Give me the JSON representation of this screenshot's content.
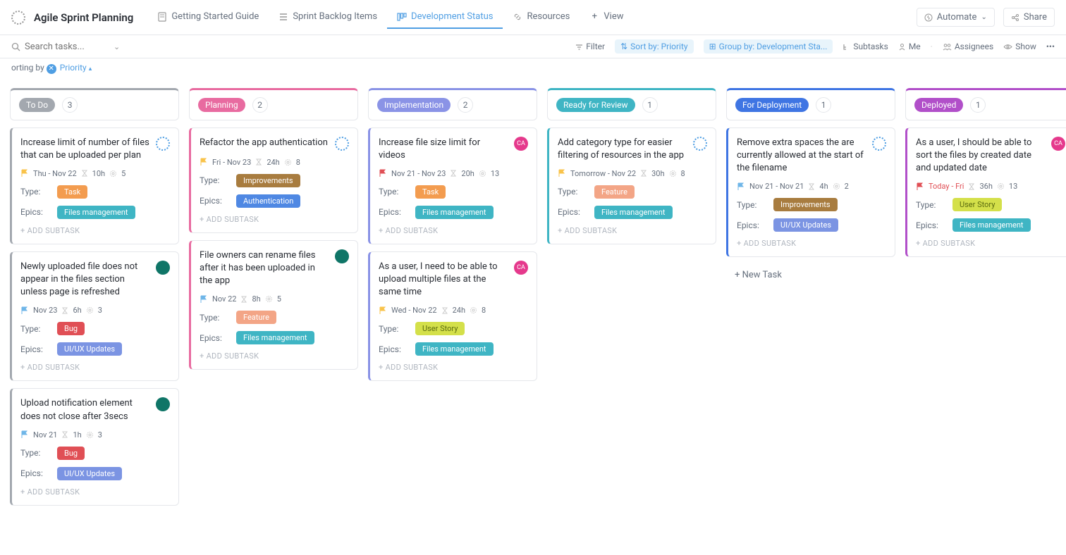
{
  "header": {
    "title": "Agile Sprint Planning",
    "tabs": [
      {
        "label": "Getting Started Guide"
      },
      {
        "label": "Sprint Backlog Items"
      },
      {
        "label": "Development Status"
      },
      {
        "label": "Resources"
      },
      {
        "label": "View"
      }
    ],
    "automate": "Automate",
    "share": "Share"
  },
  "toolbar": {
    "search_placeholder": "Search tasks...",
    "filter": "Filter",
    "sort": "Sort by: Priority",
    "group": "Group by: Development Sta...",
    "subtasks": "Subtasks",
    "me": "Me",
    "assignees": "Assignees",
    "show": "Show"
  },
  "sort_row": {
    "prefix": "orting by",
    "value": "Priority"
  },
  "add_subtask": "+ ADD SUBTASK",
  "new_task": "+ New Task",
  "type_label": "Type:",
  "epics_label": "Epics:",
  "columns": [
    {
      "name": "To Do",
      "color": "#a3a8af",
      "count": "3",
      "cards": [
        {
          "title": "Increase limit of number of files that can be uploaded per plan",
          "avatar": "spin",
          "flag": "yellow",
          "date": "Thu  -  Nov 22",
          "hours": "10h",
          "pts": "5",
          "type": "Task",
          "type_class": "tag-task",
          "epic": "Files management",
          "epic_class": "tag-files"
        },
        {
          "title": "Newly uploaded file does not appear in the files section unless page is refreshed",
          "avatar": "teal",
          "flag": "blue",
          "date": "Nov 23",
          "hours": "6h",
          "pts": "3",
          "type": "Bug",
          "type_class": "tag-bug",
          "epic": "UI/UX Updates",
          "epic_class": "tag-uiux"
        },
        {
          "title": "Upload notification element does not close after 3secs",
          "avatar": "teal",
          "flag": "blue",
          "date": "Nov 21",
          "hours": "1h",
          "pts": "3",
          "type": "Bug",
          "type_class": "tag-bug",
          "epic": "UI/UX Updates",
          "epic_class": "tag-uiux"
        }
      ]
    },
    {
      "name": "Planning",
      "color": "#e86ba0",
      "count": "2",
      "cards": [
        {
          "title": "Refactor the app authentication",
          "avatar": "spin",
          "flag": "yellow",
          "date": "Fri  -  Nov 23",
          "hours": "24h",
          "pts": "8",
          "type": "Improvements",
          "type_class": "tag-improve",
          "epic": "Authentication",
          "epic_class": "tag-auth"
        },
        {
          "title": "File owners can rename files after it has been uploaded in the app",
          "avatar": "teal",
          "flag": "blue",
          "date": "Nov 22",
          "hours": "8h",
          "pts": "5",
          "type": "Feature",
          "type_class": "tag-feature",
          "epic": "Files management",
          "epic_class": "tag-files"
        }
      ]
    },
    {
      "name": "Implementation",
      "color": "#8a93e6",
      "count": "2",
      "cards": [
        {
          "title": "Increase file size limit for videos",
          "avatar": "pink",
          "avatar_txt": "CA",
          "flag": "red",
          "date": "Nov 21  -  Nov 23",
          "hours": "20h",
          "pts": "13",
          "type": "Task",
          "type_class": "tag-task",
          "epic": "Files management",
          "epic_class": "tag-files"
        },
        {
          "title": "As a user, I need to be able to upload multiple files at the same time",
          "avatar": "pink",
          "avatar_txt": "CA",
          "flag": "yellow",
          "date": "Wed  -  Nov 22",
          "hours": "24h",
          "pts": "8",
          "type": "User Story",
          "type_class": "tag-story",
          "epic": "Files management",
          "epic_class": "tag-files"
        }
      ]
    },
    {
      "name": "Ready for Review",
      "color": "#3fb5c4",
      "count": "1",
      "cards": [
        {
          "title": "Add category type for easier filtering of resources in the app",
          "avatar": "spin",
          "flag": "yellow",
          "date": "Tomorrow  -  Nov 22",
          "hours": "30h",
          "pts": "8",
          "type": "Feature",
          "type_class": "tag-feature",
          "epic": "Files management",
          "epic_class": "tag-files"
        }
      ]
    },
    {
      "name": "For Deployment",
      "color": "#3f75e3",
      "count": "1",
      "new_task": true,
      "cards": [
        {
          "title": "Remove extra spaces the are currently allowed at the start of the filename",
          "avatar": "spin",
          "flag": "blue",
          "date": "Nov 21  -  Nov 21",
          "hours": "4h",
          "pts": "2",
          "type": "Improvements",
          "type_class": "tag-improve",
          "epic": "UI/UX Updates",
          "epic_class": "tag-uiux"
        }
      ]
    },
    {
      "name": "Deployed",
      "color": "#b14fc9",
      "count": "1",
      "cards": [
        {
          "title": "As a user, I should be able to sort the files by created date and updated date",
          "avatar": "pink",
          "avatar_txt": "CA",
          "flag": "red",
          "date": "Today  -  Fri",
          "date_color": "#e04f55",
          "hours": "36h",
          "pts": "13",
          "type": "User Story",
          "type_class": "tag-story",
          "epic": "Files management",
          "epic_class": "tag-files"
        }
      ]
    }
  ]
}
